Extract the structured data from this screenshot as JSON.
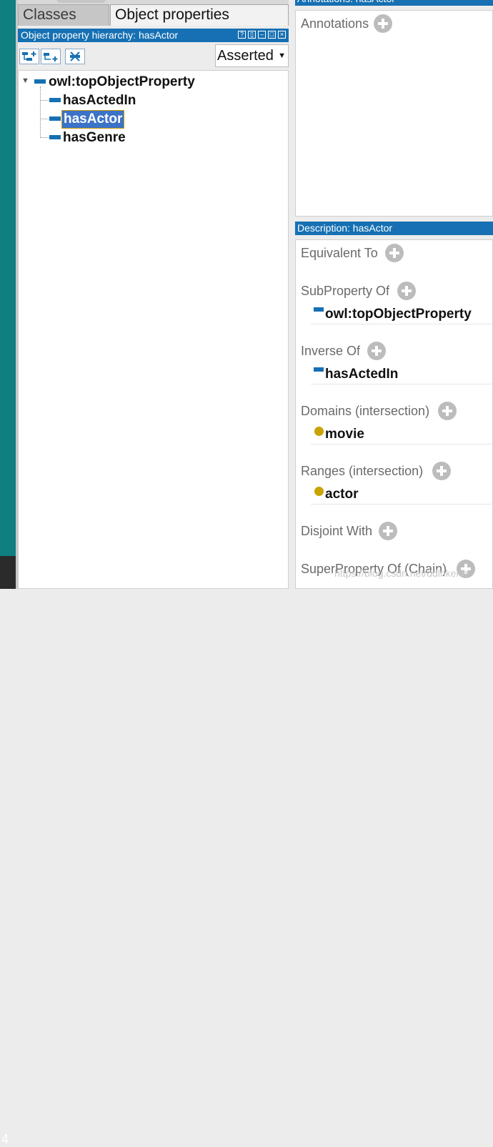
{
  "tabs": {
    "classes": "Classes",
    "object_properties": "Object properties"
  },
  "left_panel": {
    "header": "Object property hierarchy: hasActor",
    "window_buttons": [
      "?",
      "▯",
      "–",
      "□",
      "×"
    ],
    "toolbar": {
      "add_sub_icon": "add-subproperty-icon",
      "add_sibling_icon": "add-sibling-property-icon",
      "delete_icon": "delete-property-icon"
    },
    "view_mode": "Asserted",
    "tree": {
      "root": "owl:topObjectProperty",
      "children": [
        "hasActedIn",
        "hasActor",
        "hasGenre"
      ],
      "selected": "hasActor"
    }
  },
  "annotations_panel": {
    "header": "Annotations: hasActor",
    "label": "Annotations"
  },
  "description_panel": {
    "header": "Description: hasActor",
    "sections": {
      "equivalent_to": {
        "label": "Equivalent To"
      },
      "subproperty_of": {
        "label": "SubProperty Of",
        "items": [
          "owl:topObjectProperty"
        ]
      },
      "inverse_of": {
        "label": "Inverse Of",
        "items": [
          "hasActedIn"
        ]
      },
      "domains": {
        "label": "Domains (intersection)",
        "items": [
          "movie"
        ]
      },
      "ranges": {
        "label": "Ranges (intersection)",
        "items": [
          "actor"
        ]
      },
      "disjoint_with": {
        "label": "Disjoint With"
      },
      "superproperty_chain": {
        "label": "SuperProperty Of (Chain)"
      }
    }
  },
  "watermark": "https://blog.csdn.net/ddlnkenh",
  "corner_digit": "4",
  "colors": {
    "accent": "#1670b3",
    "teal": "#0f7f80",
    "class_dot": "#c9a400",
    "selection": "#3b73c9"
  }
}
